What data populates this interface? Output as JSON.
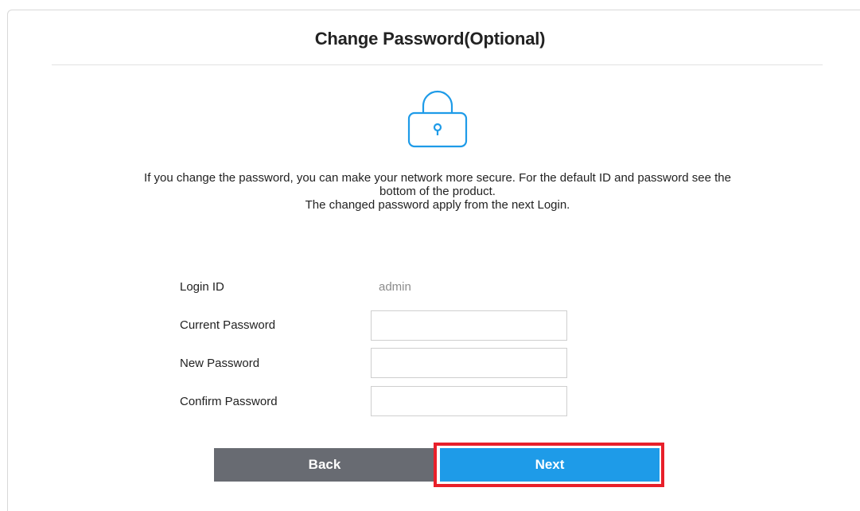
{
  "page": {
    "title": "Change Password(Optional)",
    "icon": "lock-icon",
    "description_lines": [
      "If you change the password, you can make your network more secure. For the default ID and password see the bottom of the product.",
      "The changed password apply from the next Login."
    ]
  },
  "form": {
    "login_id_label": "Login ID",
    "login_id_value": "admin",
    "current_password_label": "Current Password",
    "current_password_value": "",
    "new_password_label": "New Password",
    "new_password_value": "",
    "confirm_password_label": "Confirm Password",
    "confirm_password_value": ""
  },
  "buttons": {
    "back_label": "Back",
    "next_label": "Next"
  },
  "colors": {
    "accent": "#1e9be8",
    "back_button": "#686b72",
    "highlight": "#e8202a"
  }
}
